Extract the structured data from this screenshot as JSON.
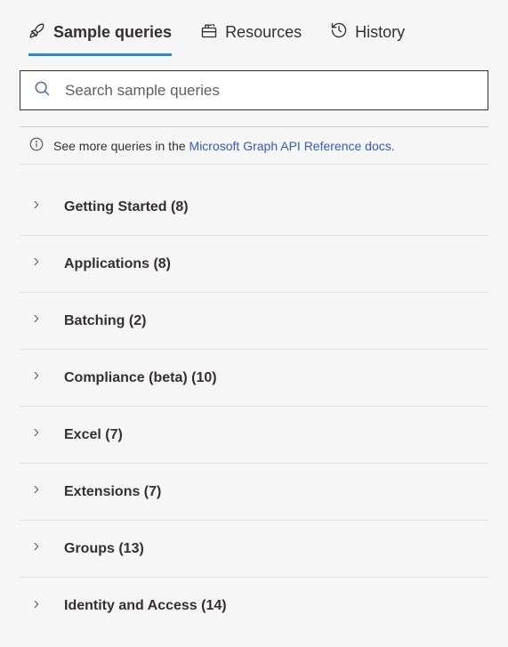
{
  "tabs": {
    "sample_queries": {
      "label": "Sample queries"
    },
    "resources": {
      "label": "Resources"
    },
    "history": {
      "label": "History"
    }
  },
  "search": {
    "placeholder": "Search sample queries"
  },
  "info": {
    "text": "See more queries in the ",
    "link": "Microsoft Graph API Reference docs."
  },
  "categories": [
    {
      "label": "Getting Started (8)"
    },
    {
      "label": "Applications (8)"
    },
    {
      "label": "Batching (2)"
    },
    {
      "label": "Compliance (beta) (10)"
    },
    {
      "label": "Excel (7)"
    },
    {
      "label": "Extensions (7)"
    },
    {
      "label": "Groups (13)"
    },
    {
      "label": "Identity and Access (14)"
    }
  ]
}
